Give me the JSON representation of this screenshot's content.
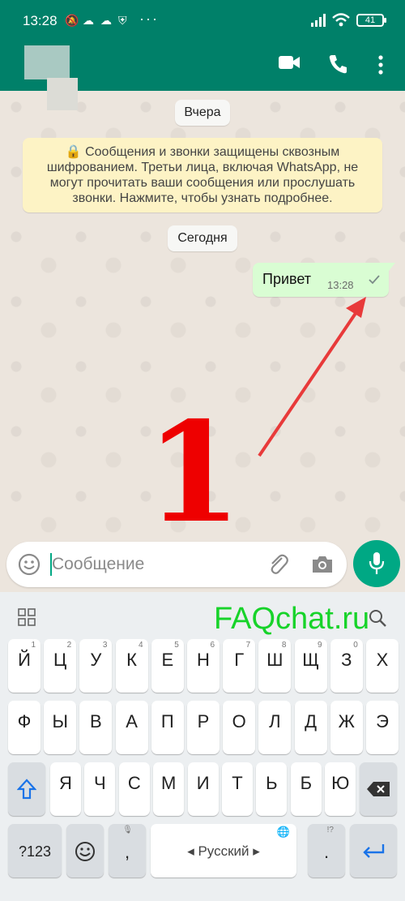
{
  "status_bar": {
    "time": "13:28",
    "battery": "41"
  },
  "chat": {
    "date_yesterday": "Вчера",
    "encryption_notice": "🔒 Сообщения и звонки защищены сквозным шифрованием. Третьи лица, включая WhatsApp, не могут прочитать ваши сообщения или прослушать звонки. Нажмите, чтобы узнать подробнее.",
    "date_today": "Сегодня",
    "message": {
      "text": "Привет",
      "time": "13:28"
    }
  },
  "annotation": {
    "number": "1",
    "color": "#ee0000"
  },
  "input": {
    "placeholder": "Сообщение"
  },
  "watermark": "FAQchat.ru",
  "keyboard": {
    "row1": [
      {
        "l": "Й",
        "h": "1"
      },
      {
        "l": "Ц",
        "h": "2"
      },
      {
        "l": "У",
        "h": "3"
      },
      {
        "l": "К",
        "h": "4"
      },
      {
        "l": "Е",
        "h": "5"
      },
      {
        "l": "Н",
        "h": "6"
      },
      {
        "l": "Г",
        "h": "7"
      },
      {
        "l": "Ш",
        "h": "8"
      },
      {
        "l": "Щ",
        "h": "9"
      },
      {
        "l": "З",
        "h": "0"
      },
      {
        "l": "Х",
        "h": ""
      }
    ],
    "row2": [
      "Ф",
      "Ы",
      "В",
      "А",
      "П",
      "Р",
      "О",
      "Л",
      "Д",
      "Ж",
      "Э"
    ],
    "row3": [
      "Я",
      "Ч",
      "С",
      "М",
      "И",
      "Т",
      "Ь",
      "Б",
      "Ю"
    ],
    "numbers_key": "?123",
    "comma": ",",
    "space_label": "Русский",
    "period": ".",
    "period_hint": "!?"
  },
  "colors": {
    "header": "#008069",
    "accent": "#00a884",
    "outgoing": "#d9fdd3",
    "notice": "#fdf3c5"
  }
}
